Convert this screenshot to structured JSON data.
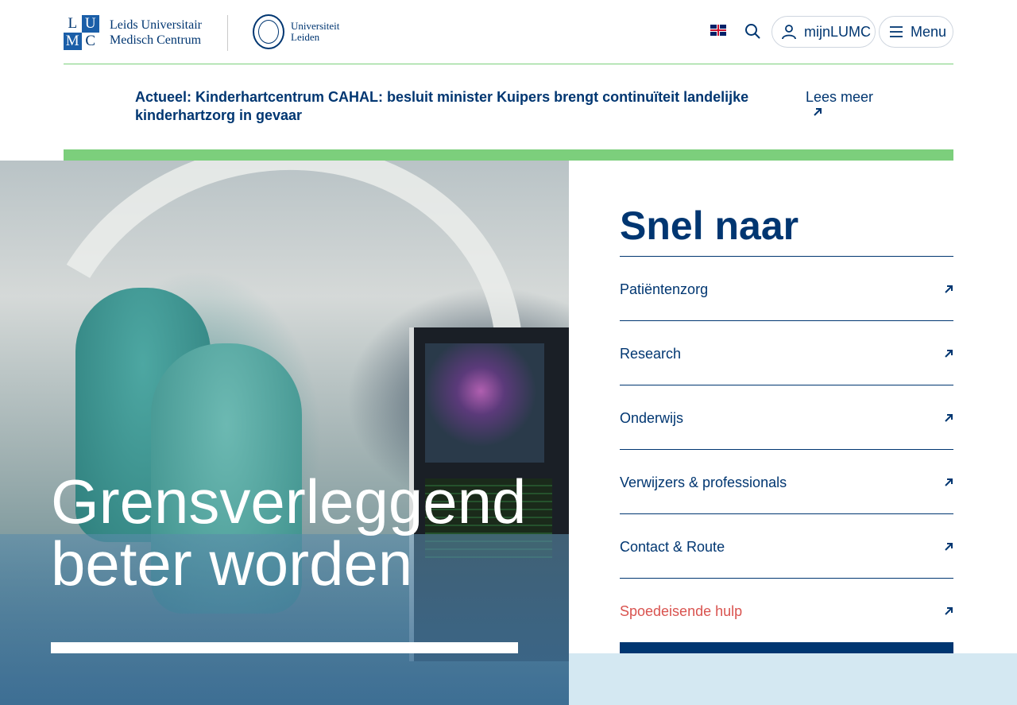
{
  "header": {
    "lumc_logo": {
      "letters": [
        "L",
        "U",
        "M",
        "C"
      ],
      "line1": "Leids Universitair",
      "line2": "Medisch Centrum"
    },
    "leiden_logo": {
      "line1": "Universiteit",
      "line2": "Leiden"
    },
    "language_icon": "uk-flag-icon",
    "search_icon": "search-icon",
    "mijn_label": "mijnLUMC",
    "menu_label": "Menu"
  },
  "news": {
    "text": "Actueel: Kinderhartcentrum CAHAL: besluit minister Kuipers brengt continuïteit landelijke kinderhartzorg in gevaar",
    "more_label": "Lees meer"
  },
  "hero": {
    "line1": "Grensverleggend",
    "line2": "beter worden"
  },
  "quick_links": {
    "title": "Snel naar",
    "items": [
      {
        "label": "Patiëntenzorg"
      },
      {
        "label": "Research"
      },
      {
        "label": "Onderwijs"
      },
      {
        "label": "Verwijzers & professionals"
      },
      {
        "label": "Contact & Route"
      },
      {
        "label": "Spoedeisende hulp"
      }
    ]
  },
  "colors": {
    "primary": "#003671",
    "accent_green": "#7ccf7c",
    "urgent": "#d9534f",
    "light_blue": "#d4e8f2"
  }
}
